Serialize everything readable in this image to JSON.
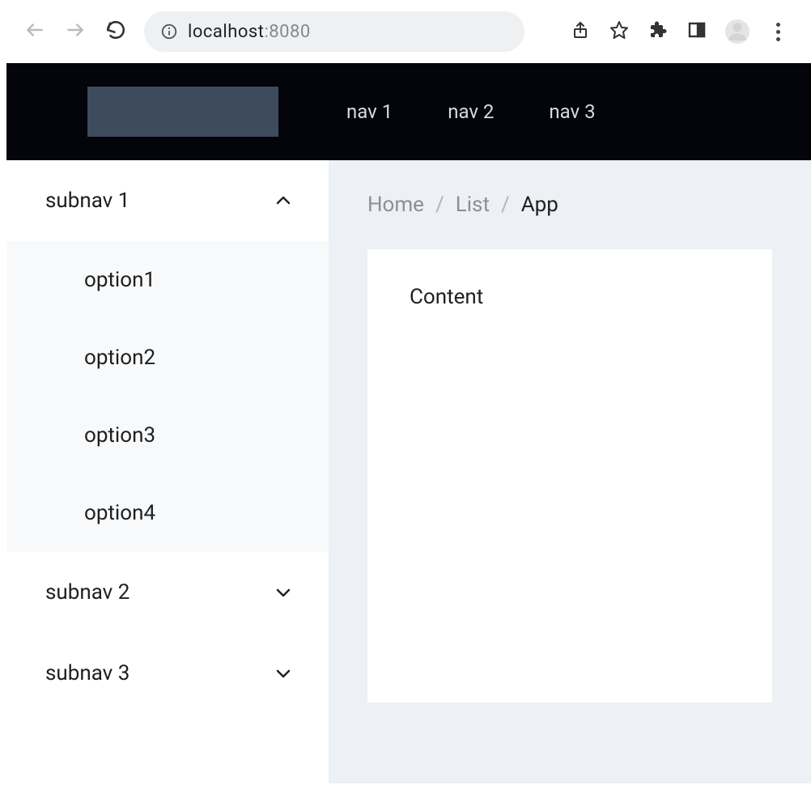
{
  "browser": {
    "url": {
      "host": "localhost",
      "port": ":8080"
    }
  },
  "header": {
    "nav": [
      "nav 1",
      "nav 2",
      "nav 3"
    ]
  },
  "sidebar": {
    "items": [
      {
        "label": "subnav 1",
        "expanded": true,
        "children": [
          "option1",
          "option2",
          "option3",
          "option4"
        ]
      },
      {
        "label": "subnav 2",
        "expanded": false
      },
      {
        "label": "subnav 3",
        "expanded": false
      }
    ]
  },
  "main": {
    "breadcrumb": {
      "home": "Home",
      "list": "List",
      "current": "App"
    },
    "content": "Content"
  }
}
